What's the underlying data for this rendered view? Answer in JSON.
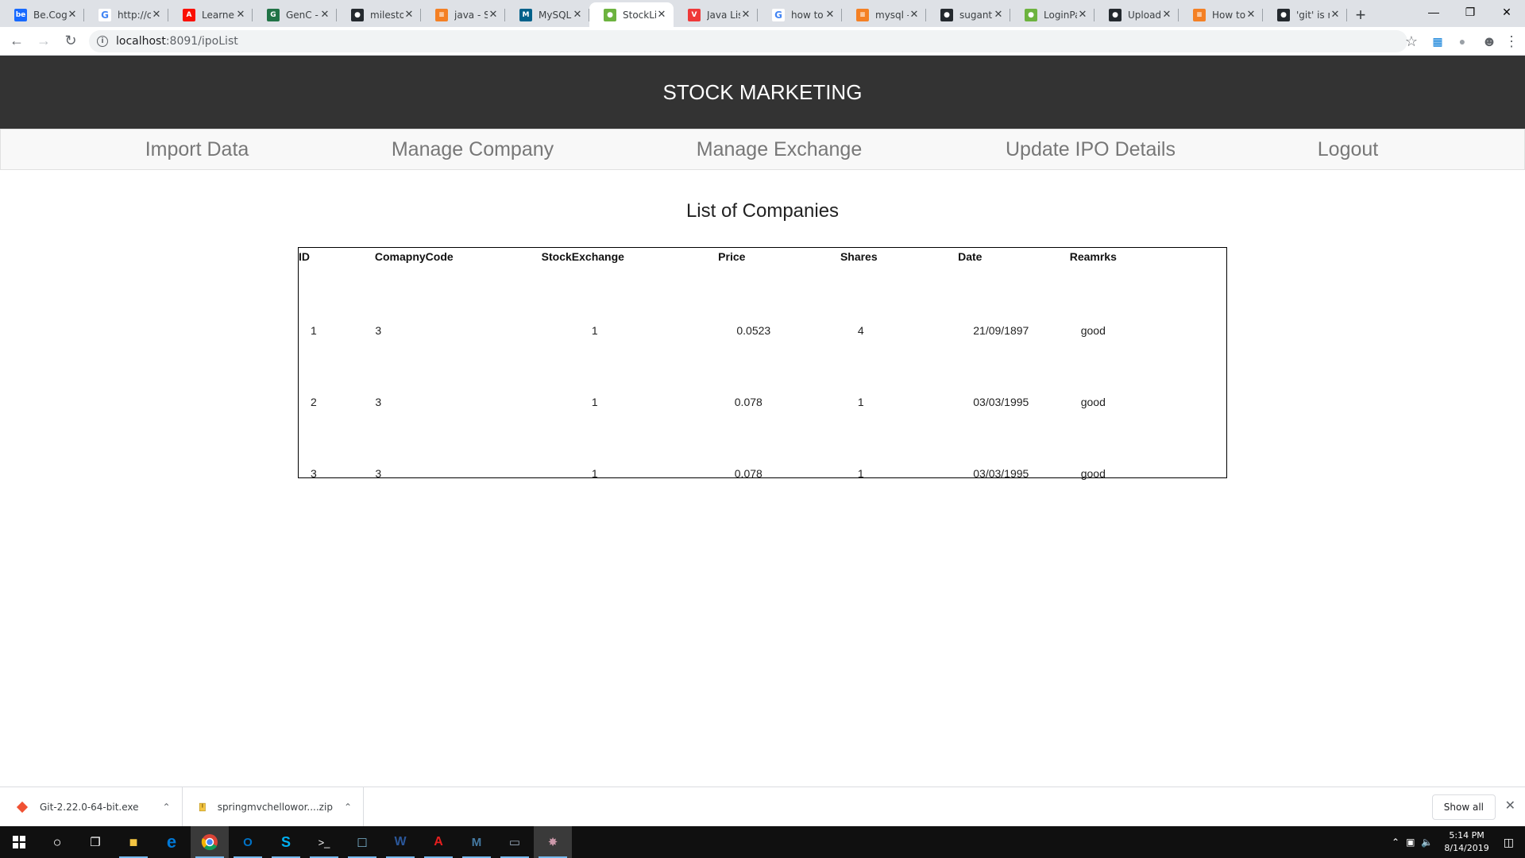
{
  "browser": {
    "tabs": [
      {
        "title": "Be.Cogni",
        "favicon": "behance-icon",
        "color": "#1769ff",
        "glyph": "be"
      },
      {
        "title": "http://c",
        "favicon": "google-icon",
        "color": "#ffffff",
        "glyph": "G"
      },
      {
        "title": "Learner",
        "favicon": "adobe-icon",
        "color": "#fa0f00",
        "glyph": "A"
      },
      {
        "title": "GenC - ",
        "favicon": "genc-icon",
        "color": "#217346",
        "glyph": "G"
      },
      {
        "title": "mileston",
        "favicon": "github-icon",
        "color": "#24292e",
        "glyph": "●"
      },
      {
        "title": "java - Sp",
        "favicon": "stackoverflow-icon",
        "color": "#f48024",
        "glyph": "≡"
      },
      {
        "title": "MySQL ",
        "favicon": "mysql-icon",
        "color": "#00618a",
        "glyph": "M"
      },
      {
        "title": "StockLis",
        "favicon": "spring-leaf-icon",
        "color": "#6db33f",
        "glyph": "●",
        "active": true
      },
      {
        "title": "Java Lis",
        "favicon": "vivaldi-icon",
        "color": "#ef3939",
        "glyph": "V"
      },
      {
        "title": "how to ",
        "favicon": "google-icon",
        "color": "#ffffff",
        "glyph": "G"
      },
      {
        "title": "mysql - ",
        "favicon": "stackoverflow-icon",
        "color": "#f48024",
        "glyph": "≡"
      },
      {
        "title": "suganth",
        "favicon": "github-icon",
        "color": "#24292e",
        "glyph": "●"
      },
      {
        "title": "LoginPa",
        "favicon": "spring-leaf-icon",
        "color": "#6db33f",
        "glyph": "●"
      },
      {
        "title": "Upload ",
        "favicon": "github-icon",
        "color": "#24292e",
        "glyph": "●"
      },
      {
        "title": "How to ",
        "favicon": "stackoverflow-icon",
        "color": "#f48024",
        "glyph": "≡"
      },
      {
        "title": "'git' is n",
        "favicon": "github-icon",
        "color": "#24292e",
        "glyph": "●"
      }
    ],
    "url_host": "localhost",
    "url_rest": ":8091/ipoList"
  },
  "page": {
    "brand": "STOCK MARKETING",
    "nav": [
      "Import Data",
      "Manage Company",
      "Manage Exchange",
      "Update IPO Details",
      "Logout"
    ],
    "list_title": "List of Companies",
    "table": {
      "headers": [
        "ID",
        "ComapnyCode",
        "StockExchange",
        "Price",
        "Shares",
        "Date",
        "Reamrks"
      ],
      "rows": [
        [
          "1",
          "3",
          "1",
          "0.0523",
          "4",
          "21/09/1897",
          "good"
        ],
        [
          "2",
          "3",
          "1",
          "0.078",
          "1",
          "03/03/1995",
          "good"
        ],
        [
          "3",
          "3",
          "1",
          "0.078",
          "1",
          "03/03/1995",
          "good"
        ]
      ]
    }
  },
  "downloads": {
    "items": [
      "Git-2.22.0-64-bit.exe",
      "springmvchellowor....zip"
    ],
    "show_all": "Show all"
  },
  "taskbar": {
    "time": "5:14 PM",
    "date": "8/14/2019"
  }
}
